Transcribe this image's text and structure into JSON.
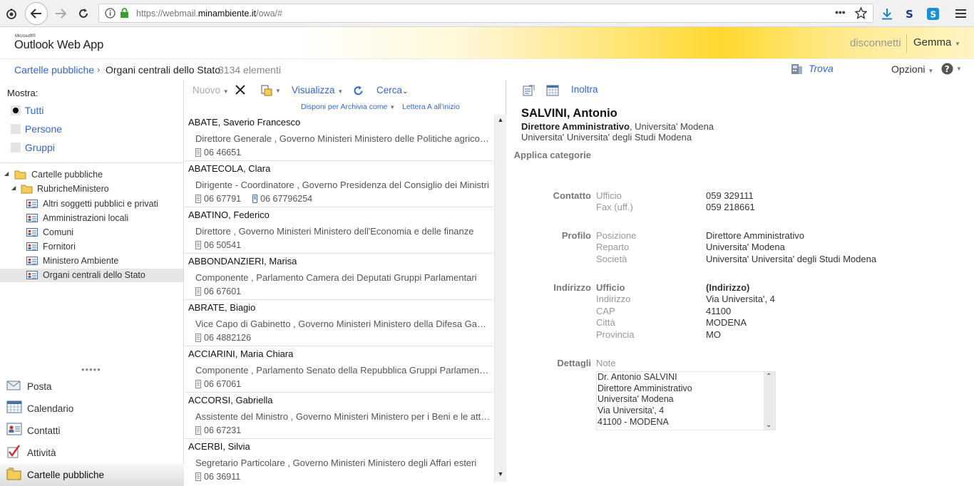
{
  "browser": {
    "url_prefix": "https://webmail.",
    "url_domain": "minambiente.it",
    "url_suffix": "/owa/#"
  },
  "header": {
    "logo_small": "Microsoft®",
    "logo": "Outlook Web App",
    "disconnect": "disconnetti",
    "user": "Gemma"
  },
  "breadcrumb": {
    "root": "Cartelle pubbliche",
    "separator": "›",
    "current": "Organi centrali dello Stato",
    "count": "3134 elementi",
    "find": "Trova",
    "options": "Opzioni"
  },
  "left": {
    "show_label": "Mostra:",
    "filters": [
      {
        "label": "Tutti",
        "selected": true
      },
      {
        "label": "Persone",
        "selected": false
      },
      {
        "label": "Gruppi",
        "selected": false
      }
    ],
    "tree": {
      "root": "Cartelle pubbliche",
      "sub": "RubricheMinistero",
      "items": [
        "Altri soggetti pubblici e privati",
        "Amministrazioni locali",
        "Comuni",
        "Fornitori",
        "Ministero Ambiente",
        "Organi centrali dello Stato"
      ],
      "selected_index": 5
    },
    "nav": [
      "Posta",
      "Calendario",
      "Contatti",
      "Attività",
      "Cartelle pubbliche"
    ],
    "nav_selected_index": 4
  },
  "toolbar": {
    "new": "Nuovo",
    "view": "Visualizza",
    "search": "Cerca",
    "arrange": "Disponi per Archivia come",
    "letter": "Lettera A all'inizio"
  },
  "list": [
    {
      "name": "ABATE, Saverio Francesco",
      "title": "Direttore Generale , Governo Ministeri Ministero delle Politiche agricole alimentari e forestali",
      "phone": "06 46651",
      "phone2": ""
    },
    {
      "name": "ABATECOLA, Clara",
      "title": "Dirigente - Coordinatore , Governo Presidenza del Consiglio dei Ministri",
      "phone": "06 67791",
      "phone2": "06 67796254"
    },
    {
      "name": "ABATINO, Federico",
      "title": "Direttore , Governo Ministeri Ministero dell'Economia e delle finanze",
      "phone": "06 50541",
      "phone2": ""
    },
    {
      "name": "ABBONDANZIERI, Marisa",
      "title": "Componente , Parlamento Camera dei Deputati Gruppi Parlamentari",
      "phone": "06 67601",
      "phone2": ""
    },
    {
      "name": "ABRATE, Biagio",
      "title": "Vice Capo di Gabinetto , Governo Ministeri Ministero della Difesa Gabinetto",
      "phone": "06 4882126",
      "phone2": ""
    },
    {
      "name": "ACCIARINI, Maria Chiara",
      "title": "Componente , Parlamento Senato della Repubblica Gruppi Parlamentari",
      "phone": "06 67061",
      "phone2": ""
    },
    {
      "name": "ACCORSI, Gabriella",
      "title": "Assistente del Ministro , Governo Ministeri Ministero per i Beni e le attività culturali",
      "phone": "06 67231",
      "phone2": ""
    },
    {
      "name": "ACERBI, Silvia",
      "title": "Segretario Particolare , Governo Ministeri Ministero degli Affari esteri",
      "phone": "06 36911",
      "phone2": ""
    }
  ],
  "reading": {
    "forward": "Inoltra",
    "name": "SALVINI, Antonio",
    "line1_bold": "Direttore Amministrativo",
    "line1_rest": ", Universita' Modena",
    "line2": "Universita' Universita' degli Studi Modena",
    "categories_label": "Applica categorie",
    "contact": {
      "label": "Contatto",
      "office_label": "Ufficio",
      "office": "059 329111",
      "fax_label": "Fax (uff.)",
      "fax": "059 218661"
    },
    "profile": {
      "label": "Profilo",
      "position_label": "Posizione",
      "position": "Direttore Amministrativo",
      "department_label": "Reparto",
      "department": "Universita' Modena",
      "company_label": "Società",
      "company": "Universita' Universita' degli Studi Modena"
    },
    "address": {
      "label": "Indirizzo",
      "type_label": "Ufficio",
      "type": "(Indirizzo)",
      "street_label": "Indirizzo",
      "street": "Via Universita', 4",
      "zip_label": "CAP",
      "zip": "41100",
      "city_label": "Città",
      "city": "MODENA",
      "province_label": "Provincia",
      "province": "MO"
    },
    "details": {
      "label": "Dettagli",
      "notes_label": "Note",
      "notes": [
        "Dr. Antonio SALVINI",
        "Direttore Amministrativo",
        "Universita' Modena",
        "Via Universita', 4",
        "41100 - MODENA"
      ]
    }
  }
}
